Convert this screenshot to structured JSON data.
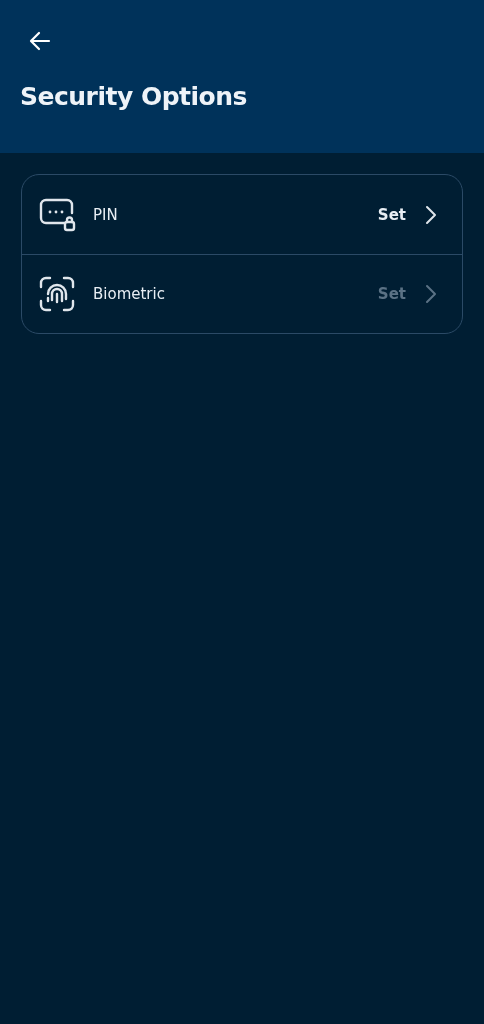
{
  "header": {
    "title": "Security Options"
  },
  "options": [
    {
      "kind": "pin",
      "label": "PIN",
      "action": "Set",
      "disabled": false
    },
    {
      "kind": "biometric",
      "label": "Biometric",
      "action": "Set",
      "disabled": true
    }
  ]
}
